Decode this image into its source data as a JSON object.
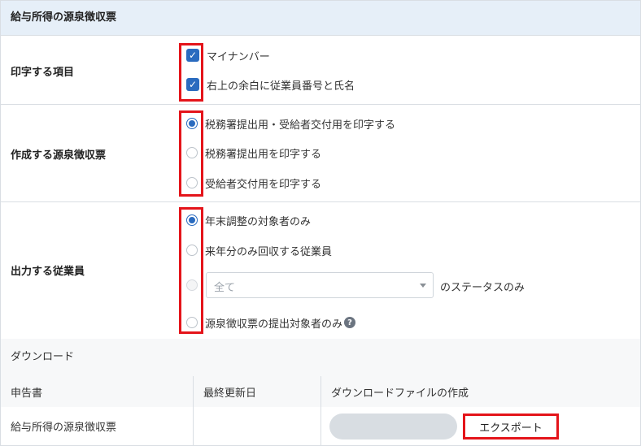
{
  "header": {
    "title": "給与所得の源泉徴収票"
  },
  "print_items": {
    "label": "印字する項目",
    "options": [
      {
        "label": "マイナンバー",
        "checked": true
      },
      {
        "label": "右上の余白に従業員番号と氏名",
        "checked": true
      }
    ]
  },
  "slip_type": {
    "label": "作成する源泉徴収票",
    "options": [
      {
        "label": "税務署提出用・受給者交付用を印字する",
        "selected": true
      },
      {
        "label": "税務署提出用を印字する",
        "selected": false
      },
      {
        "label": "受給者交付用を印字する",
        "selected": false
      }
    ]
  },
  "employees": {
    "label": "出力する従業員",
    "options": [
      {
        "label": "年末調整の対象者のみ",
        "selected": true
      },
      {
        "label": "来年分のみ回収する従業員",
        "selected": false
      },
      {
        "label": "のステータスのみ",
        "selected": false
      },
      {
        "label": "源泉徴収票の提出対象者のみ",
        "selected": false
      }
    ],
    "status_select": {
      "value": "全て"
    },
    "help_icon": "question-circle-icon"
  },
  "download": {
    "title": "ダウンロード",
    "columns": [
      "申告書",
      "最終更新日",
      "ダウンロードファイルの作成"
    ],
    "rows": [
      {
        "name": "給与所得の源泉徴収票",
        "updated": "",
        "export_label": "エクスポート"
      }
    ]
  },
  "colors": {
    "accent": "#2a6bbf",
    "highlight": "#e4141a",
    "header_bg": "#e6eff8"
  }
}
